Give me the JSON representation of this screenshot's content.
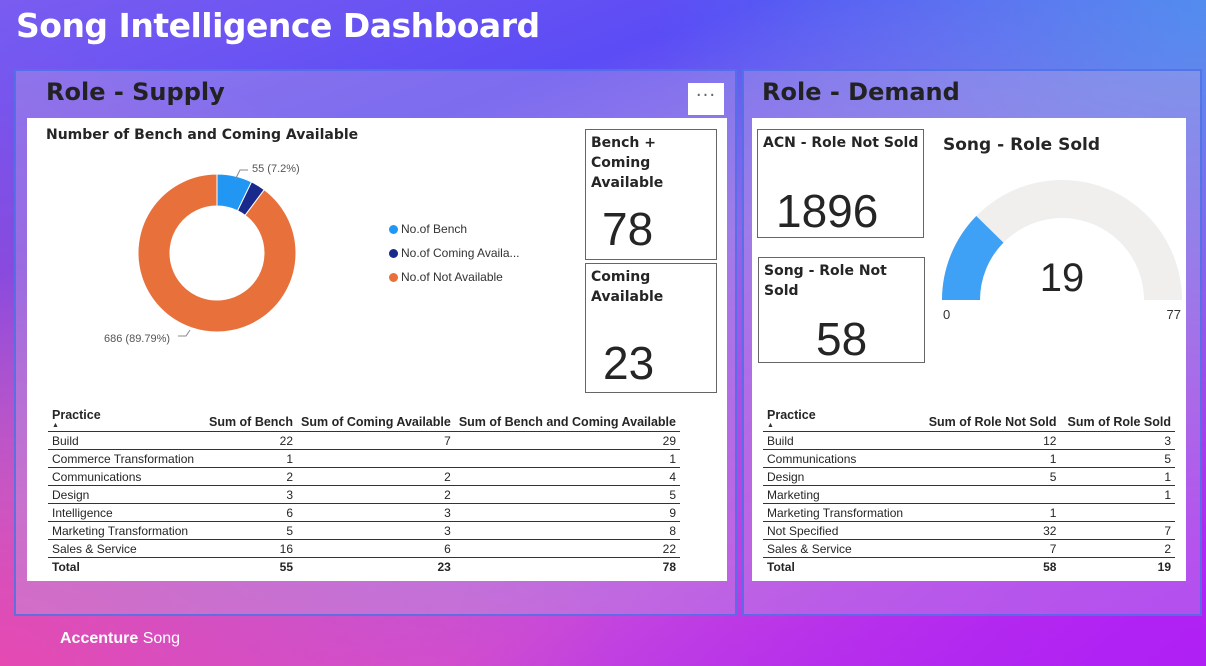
{
  "header": {
    "title": "Song Intelligence Dashboard"
  },
  "footer": {
    "brand_bold": "Accenture",
    "brand_rest": " Song"
  },
  "supply": {
    "title": "Role - Supply",
    "more_label": "···",
    "donut": {
      "title": "Number of Bench and Coming Available",
      "label_small": "55 (7.2%)",
      "label_large": "686 (89.79%)",
      "legend": [
        {
          "label": "No.of Bench",
          "color": "#2196f3"
        },
        {
          "label": "No.of Coming Availa...",
          "color": "#1a2a8c"
        },
        {
          "label": "No.of Not Available",
          "color": "#e8703a"
        }
      ]
    },
    "card_bench_coming": {
      "label": "Bench + Coming Available",
      "value": "78"
    },
    "card_coming": {
      "label": "Coming Available",
      "value": "23"
    },
    "table": {
      "headers": [
        "Practice",
        "Sum of Bench",
        "Sum of Coming Available",
        "Sum of Bench and Coming Available"
      ],
      "rows": [
        [
          "Build",
          "22",
          "7",
          "29"
        ],
        [
          "Commerce Transformation",
          "1",
          "",
          "1"
        ],
        [
          "Communications",
          "2",
          "2",
          "4"
        ],
        [
          "Design",
          "3",
          "2",
          "5"
        ],
        [
          "Intelligence",
          "6",
          "3",
          "9"
        ],
        [
          "Marketing Transformation",
          "5",
          "3",
          "8"
        ],
        [
          "Sales & Service",
          "16",
          "6",
          "22"
        ]
      ],
      "total": [
        "Total",
        "55",
        "23",
        "78"
      ]
    }
  },
  "demand": {
    "title": "Role - Demand",
    "card_acn": {
      "label": "ACN - Role Not Sold",
      "value": "1896"
    },
    "card_song": {
      "label": "Song - Role Not Sold",
      "value": "58"
    },
    "gauge": {
      "title": "Song - Role Sold",
      "value": "19",
      "min": "0",
      "max": "77",
      "fraction": 0.2468
    },
    "table": {
      "headers": [
        "Practice",
        "Sum of Role Not Sold",
        "Sum of Role Sold"
      ],
      "rows": [
        [
          "Build",
          "12",
          "3"
        ],
        [
          "Communications",
          "1",
          "5"
        ],
        [
          "Design",
          "5",
          "1"
        ],
        [
          "Marketing",
          "",
          "1"
        ],
        [
          "Marketing Transformation",
          "1",
          ""
        ],
        [
          "Not Specified",
          "32",
          "7"
        ],
        [
          "Sales & Service",
          "7",
          "2"
        ]
      ],
      "total": [
        "Total",
        "58",
        "19"
      ]
    }
  },
  "chart_data": {
    "type": "pie",
    "title": "Number of Bench and Coming Available",
    "categories": [
      "No.of Bench",
      "No.of Coming Availa...",
      "No.of Not Available"
    ],
    "values": [
      55,
      23,
      686
    ],
    "data_labels": [
      "55 (7.2%)",
      "",
      "686 (89.79%)"
    ],
    "donut": true,
    "legend": "right"
  }
}
